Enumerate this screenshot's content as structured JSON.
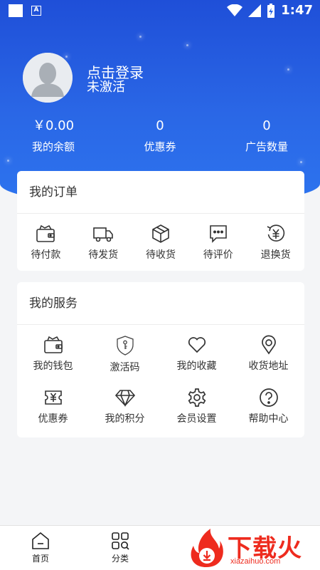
{
  "status_bar": {
    "time": "1:47"
  },
  "profile": {
    "title": "点击登录",
    "status": "未激活"
  },
  "stats": [
    {
      "value": "￥0.00",
      "label": "我的余额"
    },
    {
      "value": "0",
      "label": "优惠券"
    },
    {
      "value": "0",
      "label": "广告数量"
    }
  ],
  "orders": {
    "title": "我的订单",
    "items": [
      {
        "icon": "wallet-icon",
        "label": "待付款"
      },
      {
        "icon": "truck-icon",
        "label": "待发货"
      },
      {
        "icon": "box-icon",
        "label": "待收货"
      },
      {
        "icon": "chat-icon",
        "label": "待评价"
      },
      {
        "icon": "refund-icon",
        "label": "退换货"
      }
    ]
  },
  "services": {
    "title": "我的服务",
    "items": [
      {
        "icon": "wallet-icon",
        "label": "我的钱包"
      },
      {
        "icon": "shield-key-icon",
        "label": "激活码"
      },
      {
        "icon": "heart-icon",
        "label": "我的收藏"
      },
      {
        "icon": "location-icon",
        "label": "收货地址"
      },
      {
        "icon": "coupon-icon",
        "label": "优惠券"
      },
      {
        "icon": "diamond-icon",
        "label": "我的积分"
      },
      {
        "icon": "gear-icon",
        "label": "会员设置"
      },
      {
        "icon": "help-icon",
        "label": "帮助中心"
      }
    ]
  },
  "bottom_nav": [
    {
      "icon": "home-icon",
      "label": "首页"
    },
    {
      "icon": "category-icon",
      "label": "分类"
    }
  ],
  "watermark": {
    "text": "下载火",
    "url_text": "xiazaihuo.com"
  },
  "colors": {
    "brand_blue": "#2a67e6",
    "watermark_red": "#ee2b1e"
  }
}
